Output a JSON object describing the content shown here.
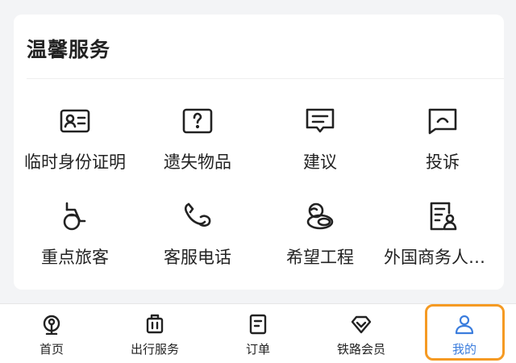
{
  "card": {
    "title": "温馨服务"
  },
  "services": [
    {
      "label": "临时身份证明",
      "icon": "id-card-icon"
    },
    {
      "label": "遗失物品",
      "icon": "lost-item-icon"
    },
    {
      "label": "建议",
      "icon": "suggestion-icon"
    },
    {
      "label": "投诉",
      "icon": "complaint-icon"
    },
    {
      "label": "重点旅客",
      "icon": "wheelchair-icon"
    },
    {
      "label": "客服电话",
      "icon": "phone-icon"
    },
    {
      "label": "希望工程",
      "icon": "hope-project-icon"
    },
    {
      "label": "外国商务人士服务",
      "icon": "foreign-business-icon"
    }
  ],
  "tabbar": {
    "items": [
      {
        "label": "首页",
        "icon": "railway-logo-icon"
      },
      {
        "label": "出行服务",
        "icon": "luggage-icon"
      },
      {
        "label": "订单",
        "icon": "order-icon"
      },
      {
        "label": "铁路会员",
        "icon": "diamond-icon"
      },
      {
        "label": "我的",
        "icon": "profile-icon",
        "active": true
      }
    ],
    "active_color": "#3b7ddd",
    "highlight_color": "#f59a23"
  }
}
